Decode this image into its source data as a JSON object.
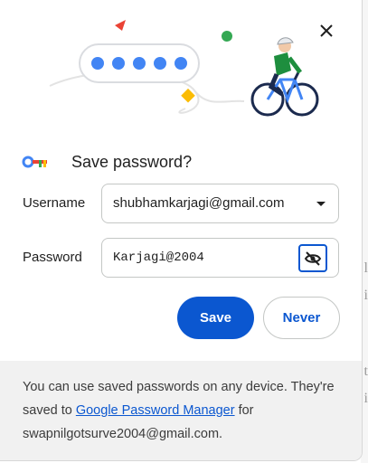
{
  "dialog": {
    "title": "Save password?",
    "close_icon": "close-icon",
    "key_icon": "key-icon",
    "illustration": "password-cyclist-illustration"
  },
  "username": {
    "label": "Username",
    "value": "shubhamkarjagi@gmail.com",
    "icon": "dropdown-arrow-icon"
  },
  "password": {
    "label": "Password",
    "value": "Karjagi@2004",
    "icon": "eye-off-icon"
  },
  "buttons": {
    "save_label": "Save",
    "never_label": "Never"
  },
  "footer": {
    "text_before": "You can use saved passwords on any device. They're saved to ",
    "link_text": "Google Password Manager",
    "text_after": " for swapnilgotsurve2004@gmail.com."
  },
  "colors": {
    "accent": "#0b57d0",
    "footer_bg": "#f1f1f1"
  }
}
